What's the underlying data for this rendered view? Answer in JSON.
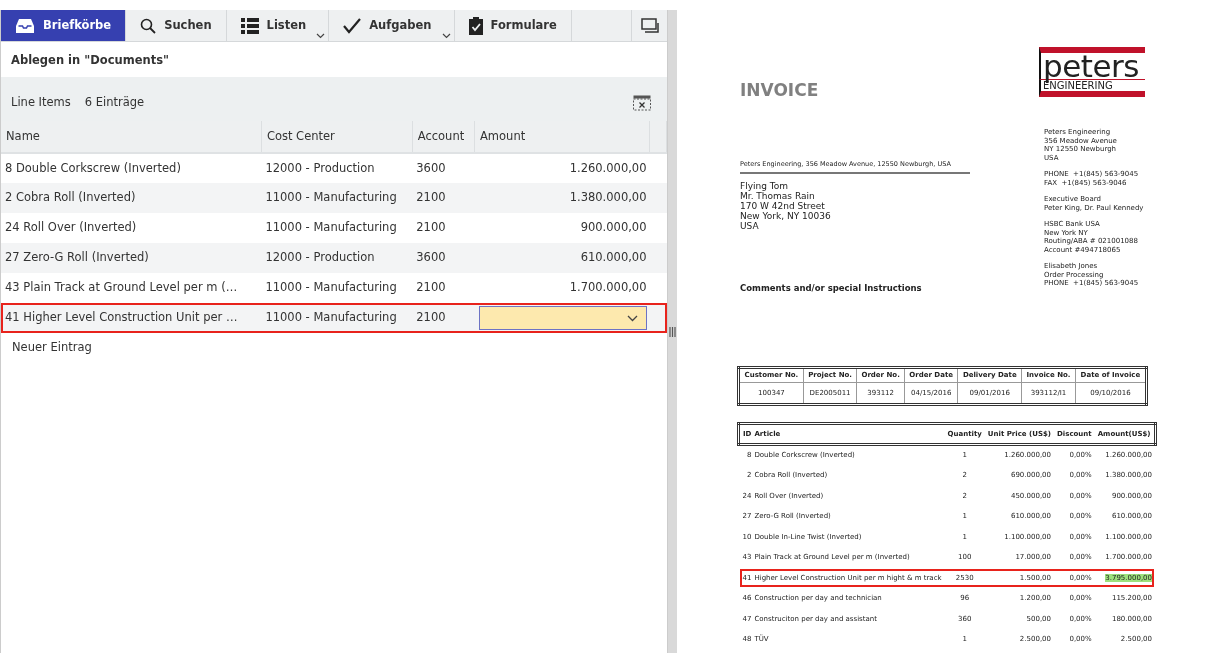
{
  "toolbar": {
    "tabs": [
      {
        "label": "Briefkörbe",
        "selected": true,
        "dropdown": false
      },
      {
        "label": "Suchen",
        "selected": false,
        "dropdown": false
      },
      {
        "label": "Listen",
        "selected": false,
        "dropdown": true
      },
      {
        "label": "Aufgaben",
        "selected": false,
        "dropdown": true
      },
      {
        "label": "Formulare",
        "selected": false,
        "dropdown": false
      }
    ]
  },
  "panel_title": "Ablegen in \"Documents\"",
  "section": {
    "label": "Line Items",
    "count": "6 Einträge"
  },
  "table": {
    "columns": [
      "Name",
      "Cost Center",
      "Account",
      "Amount"
    ],
    "rows": [
      {
        "name": "8 Double Corkscrew (Inverted)",
        "cost_center": "12000 - Production",
        "account": "3600",
        "amount": "1.260.000,00",
        "selected": false
      },
      {
        "name": "2 Cobra Roll (Inverted)",
        "cost_center": "11000 - Manufacturing",
        "account": "2100",
        "amount": "1.380.000,00",
        "selected": false
      },
      {
        "name": "24 Roll Over (Inverted)",
        "cost_center": "11000 - Manufacturing",
        "account": "2100",
        "amount": "900.000,00",
        "selected": false
      },
      {
        "name": "27 Zero-G Roll (Inverted)",
        "cost_center": "12000 - Production",
        "account": "3600",
        "amount": "610.000,00",
        "selected": false
      },
      {
        "name": "43 Plain Track at Ground Level per m (…",
        "cost_center": "11000 - Manufacturing",
        "account": "2100",
        "amount": "1.700.000,00",
        "selected": false
      },
      {
        "name": "41 Higher Level Construction Unit per …",
        "cost_center": "11000 - Manufacturing",
        "account": "2100",
        "selected": true
      }
    ]
  },
  "new_entry": "Neuer Eintrag",
  "document": {
    "title": "INVOICE",
    "logo": {
      "name": "peters",
      "tagline": "ENGINEERING"
    },
    "sender_line": "Peters Engineering, 356 Meadow Avenue,  12550 Newburgh, USA",
    "recipient": [
      "Flying Tom",
      "Mr. Thomas Rain",
      "170 W 42nd Street",
      "New York, NY 10036",
      "USA"
    ],
    "company_info": [
      [
        "Peters Engineering",
        "356 Meadow Avenue",
        "NY 12550 Newburgh",
        "USA"
      ],
      [
        "PHONE  +1(845) 563-9045",
        "FAX  +1(845) 563-9046"
      ],
      [
        "Executive Board",
        "Peter King, Dr. Paul Kennedy"
      ],
      [
        "HSBC Bank USA",
        "New York NY",
        "Routing/ABA # 021001088",
        "Account #494718065"
      ],
      [
        "Elisabeth Jones",
        "Order Processing",
        "PHONE  +1(845) 563-9045"
      ]
    ],
    "comments_heading": "Comments and/or special Instructions",
    "info_table": {
      "columns": [
        "Customer No.",
        "Project No.",
        "Order No.",
        "Order Date",
        "Delivery Date",
        "Invoice No.",
        "Date of Invoice"
      ],
      "values": [
        "100347",
        "DE2005011",
        "393112",
        "04/15/2016",
        "09/01/2016",
        "393112/I1",
        "09/10/2016"
      ]
    },
    "items_table": {
      "columns": [
        "ID",
        "Article",
        "Quantity",
        "Unit Price (US$)",
        "Discount",
        "Amount(US$)"
      ],
      "rows": [
        {
          "id": "8",
          "article": "Double Corkscrew (Inverted)",
          "quantity": "1",
          "unit_price": "1.260.000,00",
          "discount": "0,00%",
          "amount": "1.260.000,00",
          "highlighted": false
        },
        {
          "id": "2",
          "article": "Cobra Roll (Inverted)",
          "quantity": "2",
          "unit_price": "690.000,00",
          "discount": "0,00%",
          "amount": "1.380.000,00",
          "highlighted": false
        },
        {
          "id": "24",
          "article": "Roll Over (Inverted)",
          "quantity": "2",
          "unit_price": "450.000,00",
          "discount": "0,00%",
          "amount": "900.000,00",
          "highlighted": false
        },
        {
          "id": "27",
          "article": "Zero-G Roll (Inverted)",
          "quantity": "1",
          "unit_price": "610.000,00",
          "discount": "0,00%",
          "amount": "610.000,00",
          "highlighted": false
        },
        {
          "id": "10",
          "article": "Double In-Line Twist (Inverted)",
          "quantity": "1",
          "unit_price": "1.100.000,00",
          "discount": "0,00%",
          "amount": "1.100.000,00",
          "highlighted": false
        },
        {
          "id": "43",
          "article": "Plain Track at Ground Level per m (Inverted)",
          "quantity": "100",
          "unit_price": "17.000,00",
          "discount": "0,00%",
          "amount": "1.700.000,00",
          "highlighted": false
        },
        {
          "id": "41",
          "article": "Higher Level Construction Unit per m hight & m track",
          "quantity": "2530",
          "unit_price": "1.500,00",
          "discount": "0,00%",
          "amount": "3.795.000,00",
          "highlighted": true
        },
        {
          "id": "46",
          "article": "Construction per day and technician",
          "quantity": "96",
          "unit_price": "1.200,00",
          "discount": "0,00%",
          "amount": "115.200,00",
          "highlighted": false
        },
        {
          "id": "47",
          "article": "Construciton per day and assistant",
          "quantity": "360",
          "unit_price": "500,00",
          "discount": "0,00%",
          "amount": "180.000,00",
          "highlighted": false
        },
        {
          "id": "48",
          "article": "TÜV",
          "quantity": "1",
          "unit_price": "2.500,00",
          "discount": "0,00%",
          "amount": "2.500,00",
          "highlighted": false
        }
      ]
    }
  }
}
